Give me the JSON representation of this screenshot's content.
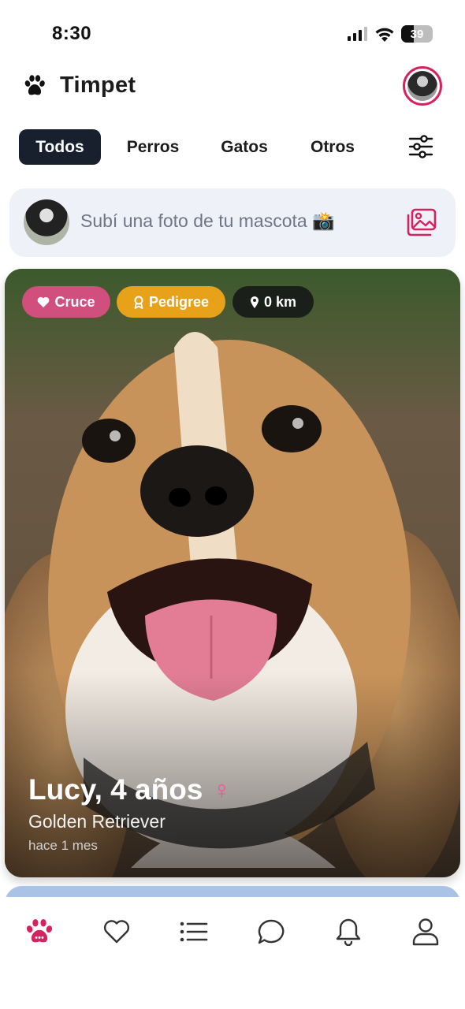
{
  "status_bar": {
    "time": "8:30",
    "battery": "39",
    "battery_level": 0.39
  },
  "header": {
    "title": "Timpet",
    "logo_icon": "paw-icon"
  },
  "tabs": [
    {
      "label": "Todos",
      "active": true
    },
    {
      "label": "Perros",
      "active": false
    },
    {
      "label": "Gatos",
      "active": false
    },
    {
      "label": "Otros",
      "active": false
    }
  ],
  "upload": {
    "prompt": "Subí una foto de tu mascota 📸"
  },
  "card": {
    "badges": {
      "cross": "Cruce",
      "pedigree": "Pedigree",
      "distance": "0 km"
    },
    "name_age": "Lucy, 4 años",
    "gender_symbol": "♀",
    "breed": "Golden Retriever",
    "posted": "hace 1 mes"
  },
  "nav": {
    "items": [
      "paw-icon",
      "heart-icon",
      "list-icon",
      "chat-icon",
      "bell-icon",
      "user-icon"
    ],
    "active_index": 0,
    "active_color": "#d6225f"
  },
  "colors": {
    "accent": "#d6225f",
    "tab_active_bg": "#17202c",
    "badge_cross": "#d14f7c",
    "badge_pedigree": "#e8a21a",
    "badge_distance": "#1a1f1a",
    "upload_bg": "#eef1f8"
  }
}
